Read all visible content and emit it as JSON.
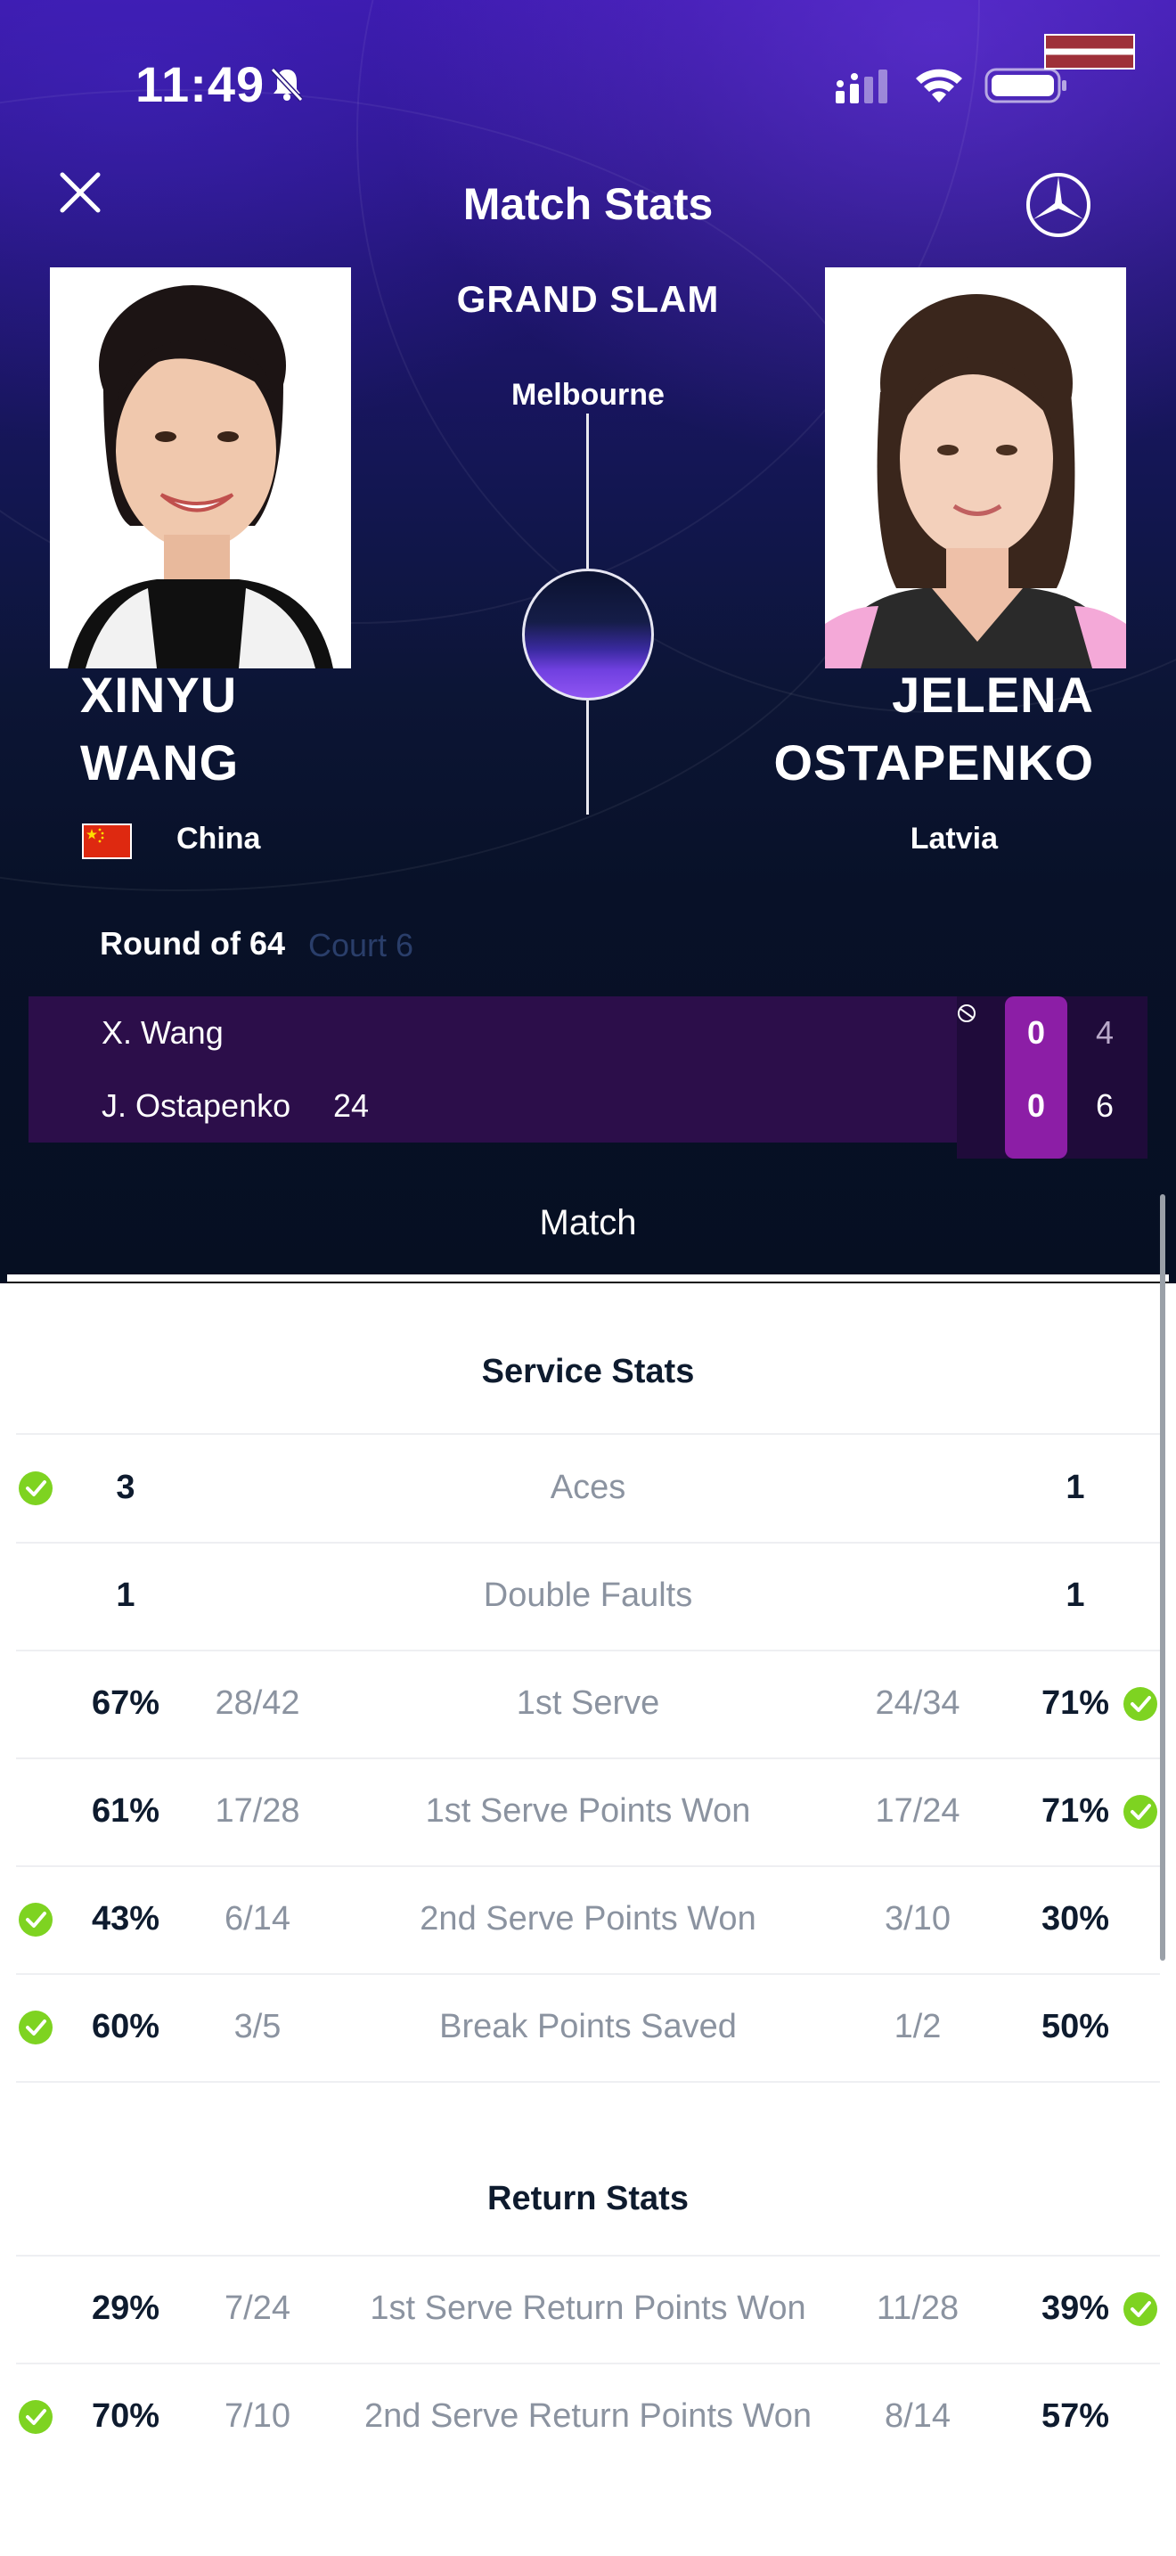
{
  "status_bar": {
    "time": "11:49"
  },
  "header": {
    "title": "Match Stats",
    "close_icon": "close-icon",
    "brand_icon": "mercedes-star-icon"
  },
  "event": {
    "name": "GRAND SLAM",
    "city": "Melbourne"
  },
  "players": {
    "left": {
      "first": "XINYU",
      "last": "WANG",
      "country": "China",
      "flag": "china-flag"
    },
    "right": {
      "first": "JELENA",
      "last": "OSTAPENKO",
      "country": "Latvia",
      "flag": "latvia-flag"
    }
  },
  "match": {
    "round": "Round of 64",
    "court": "Court 6",
    "rows": [
      {
        "name": "X. Wang",
        "seed": "",
        "current": "0",
        "set1": "4",
        "serving": true
      },
      {
        "name": "J. Ostapenko",
        "seed": "24",
        "current": "0",
        "set1": "6",
        "serving": false
      }
    ]
  },
  "tabs": {
    "active": "Match"
  },
  "colors": {
    "check_green": "#7ed321",
    "score_highlight": "#8c1ea6",
    "row_bg": "#2c0e4a"
  },
  "service_stats": {
    "title": "Service Stats",
    "rows": [
      {
        "label": "Aces",
        "left_value": "3",
        "left_fraction": "",
        "right_fraction": "",
        "right_value": "1",
        "leader": "left"
      },
      {
        "label": "Double Faults",
        "left_value": "1",
        "left_fraction": "",
        "right_fraction": "",
        "right_value": "1",
        "leader": "none"
      },
      {
        "label": "1st Serve",
        "left_value": "67%",
        "left_fraction": "28/42",
        "right_fraction": "24/34",
        "right_value": "71%",
        "leader": "right"
      },
      {
        "label": "1st Serve Points Won",
        "left_value": "61%",
        "left_fraction": "17/28",
        "right_fraction": "17/24",
        "right_value": "71%",
        "leader": "right"
      },
      {
        "label": "2nd Serve Points Won",
        "left_value": "43%",
        "left_fraction": "6/14",
        "right_fraction": "3/10",
        "right_value": "30%",
        "leader": "left"
      },
      {
        "label": "Break Points Saved",
        "left_value": "60%",
        "left_fraction": "3/5",
        "right_fraction": "1/2",
        "right_value": "50%",
        "leader": "left"
      }
    ]
  },
  "return_stats": {
    "title": "Return Stats",
    "rows": [
      {
        "label": "1st Serve Return Points Won",
        "left_value": "29%",
        "left_fraction": "7/24",
        "right_fraction": "11/28",
        "right_value": "39%",
        "leader": "right"
      },
      {
        "label": "2nd Serve Return Points Won",
        "left_value": "70%",
        "left_fraction": "7/10",
        "right_fraction": "8/14",
        "right_value": "57%",
        "leader": "left"
      }
    ]
  }
}
